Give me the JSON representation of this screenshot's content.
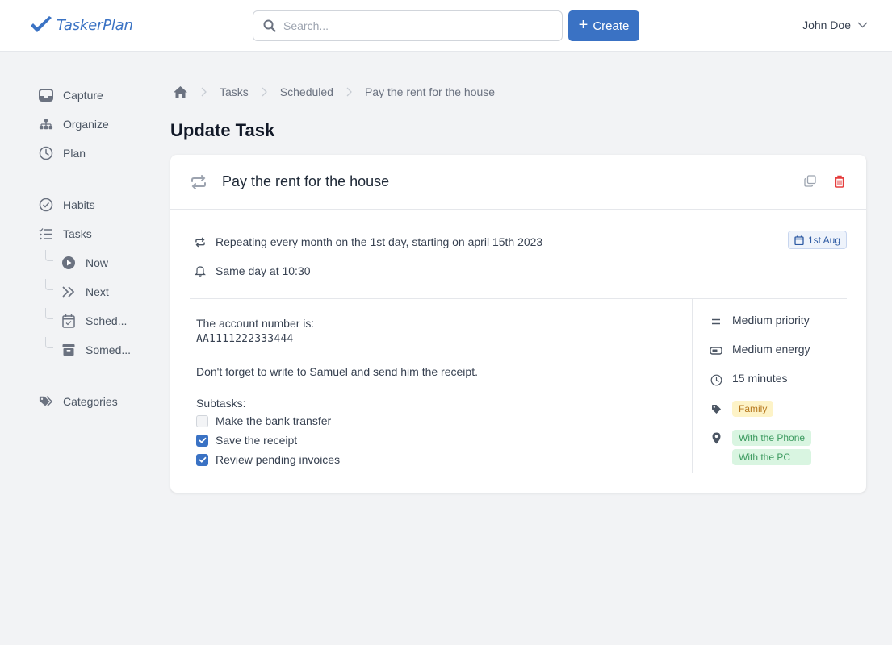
{
  "header": {
    "app_name": "TaskerPlan",
    "search_placeholder": "Search...",
    "search_value": "",
    "create_label": "Create",
    "user_name": "John Doe",
    "brand_color": "#3a72c4"
  },
  "sidebar": {
    "items": [
      {
        "label": "Capture",
        "icon": "inbox-icon"
      },
      {
        "label": "Organize",
        "icon": "hierarchy-icon"
      },
      {
        "label": "Plan",
        "icon": "clock-icon"
      },
      {
        "label": "Habits",
        "icon": "check-circle-icon"
      },
      {
        "label": "Tasks",
        "icon": "checklist-icon"
      },
      {
        "label": "Now",
        "icon": "play-icon"
      },
      {
        "label": "Next",
        "icon": "double-chevron-icon"
      },
      {
        "label": "Sched...",
        "icon": "calendar-check-icon"
      },
      {
        "label": "Somed...",
        "icon": "archive-icon"
      },
      {
        "label": "Categories",
        "icon": "tags-icon"
      }
    ]
  },
  "breadcrumb": {
    "items": [
      "Tasks",
      "Scheduled",
      "Pay the rent for the house"
    ]
  },
  "page": {
    "title": "Update Task"
  },
  "task": {
    "title": "Pay the rent for the house",
    "repeat": "Repeating every month on the 1st day, starting on april 15th 2023",
    "reminder": "Same day at 10:30",
    "date_badge": "1st Aug",
    "notes": {
      "line1": "The account number is:",
      "account": "AA1111222333444",
      "line2": "Don't forget to write to Samuel and send him the receipt.",
      "subtasks_label": "Subtasks:"
    },
    "subtasks": [
      {
        "label": "Make the bank transfer",
        "checked": false
      },
      {
        "label": "Save the receipt",
        "checked": true
      },
      {
        "label": "Review pending invoices",
        "checked": true
      }
    ],
    "properties": {
      "priority": "Medium priority",
      "energy": "Medium energy",
      "duration": "15 minutes",
      "categories": [
        "Family"
      ],
      "contexts": [
        "With the Phone",
        "With the PC"
      ]
    }
  }
}
